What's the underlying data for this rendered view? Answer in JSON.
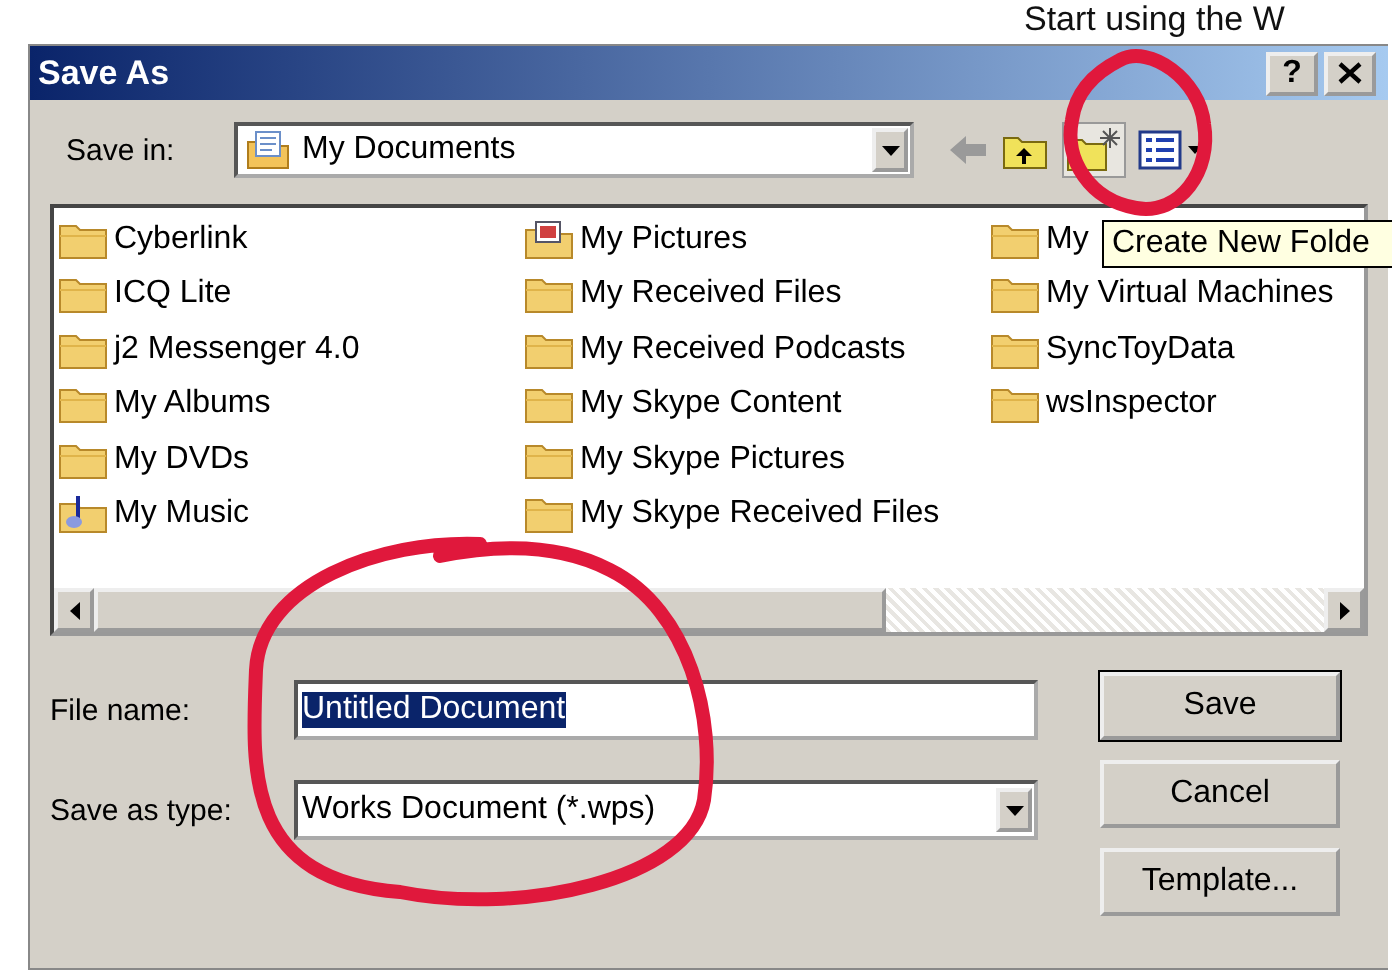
{
  "background_text": "Start using the W",
  "window": {
    "title": "Save As"
  },
  "title_buttons": [
    {
      "kind": "help",
      "label": "?"
    },
    {
      "kind": "close"
    }
  ],
  "save_in": {
    "label": "Save in:",
    "value": "My Documents"
  },
  "toolbar": [
    {
      "kind": "back"
    },
    {
      "kind": "up"
    },
    {
      "kind": "new-folder"
    },
    {
      "kind": "views"
    }
  ],
  "files": [
    {
      "name": "Cyberlink",
      "kind": "folder"
    },
    {
      "name": "ICQ Lite",
      "kind": "folder"
    },
    {
      "name": "j2 Messenger 4.0",
      "kind": "folder"
    },
    {
      "name": "My Albums",
      "kind": "folder"
    },
    {
      "name": "My DVDs",
      "kind": "folder"
    },
    {
      "name": "My Music",
      "kind": "music"
    },
    {
      "name": "My Pictures",
      "kind": "pictures"
    },
    {
      "name": "My Received Files",
      "kind": "folder"
    },
    {
      "name": "My Received Podcasts",
      "kind": "folder"
    },
    {
      "name": "My Skype Content",
      "kind": "folder"
    },
    {
      "name": "My Skype Pictures",
      "kind": "folder"
    },
    {
      "name": "My Skype Received Files",
      "kind": "folder"
    },
    {
      "name": "My",
      "kind": "folder"
    },
    {
      "name": "My Virtual Machines",
      "kind": "folder"
    },
    {
      "name": "SyncToyData",
      "kind": "folder"
    },
    {
      "name": "wsInspector",
      "kind": "folder"
    }
  ],
  "tooltip": "Create New Folde",
  "file_name": {
    "label": "File name:",
    "value": "Untitled Document",
    "selected": true
  },
  "save_as_type": {
    "label": "Save as type:",
    "value": "Works Document (*.wps)"
  },
  "buttons": [
    {
      "label": "Save",
      "default": true
    },
    {
      "label": "Cancel",
      "default": false
    },
    {
      "label": "Template...",
      "default": false
    }
  ],
  "annotations": [
    {
      "kind": "circle"
    },
    {
      "kind": "circle"
    }
  ]
}
